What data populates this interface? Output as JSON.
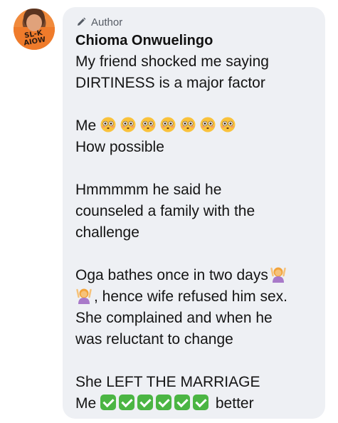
{
  "post": {
    "author_badge": "Author",
    "author_name": "Chioma Onwuelingo",
    "avatar_shirt_text": "SL-K AIOW",
    "paragraphs": {
      "p1": [
        "My friend shocked me saying",
        "DIRTINESS is a major factor"
      ],
      "p2_me": "Me",
      "p2_emoji_count": 7,
      "p2_line2": "How possible",
      "p3": [
        "Hmmmmm he said he",
        "counseled a family with the",
        "challenge"
      ],
      "p4_line1": "Oga bathes once in two days",
      "p4_line2": ", hence wife refused him sex.",
      "p4_rest": [
        "She complained and when he",
        "was reluctant to change"
      ],
      "p5_line1": "She LEFT THE MARRIAGE",
      "p5_me": "Me",
      "p5_check_count": 6,
      "p5_better": "better"
    }
  },
  "icons": {
    "pencil": "pencil-icon",
    "flushed_face": "flushed-face-emoji",
    "woman_gesturing": "woman-raising-hands-emoji",
    "check": "check-mark-button-emoji"
  },
  "colors": {
    "bubble_bg": "#eef0f4",
    "text": "#141414",
    "badge_text": "#555b64",
    "check_green": "#4bb543",
    "emoji_yellow": "#f9c23c"
  }
}
